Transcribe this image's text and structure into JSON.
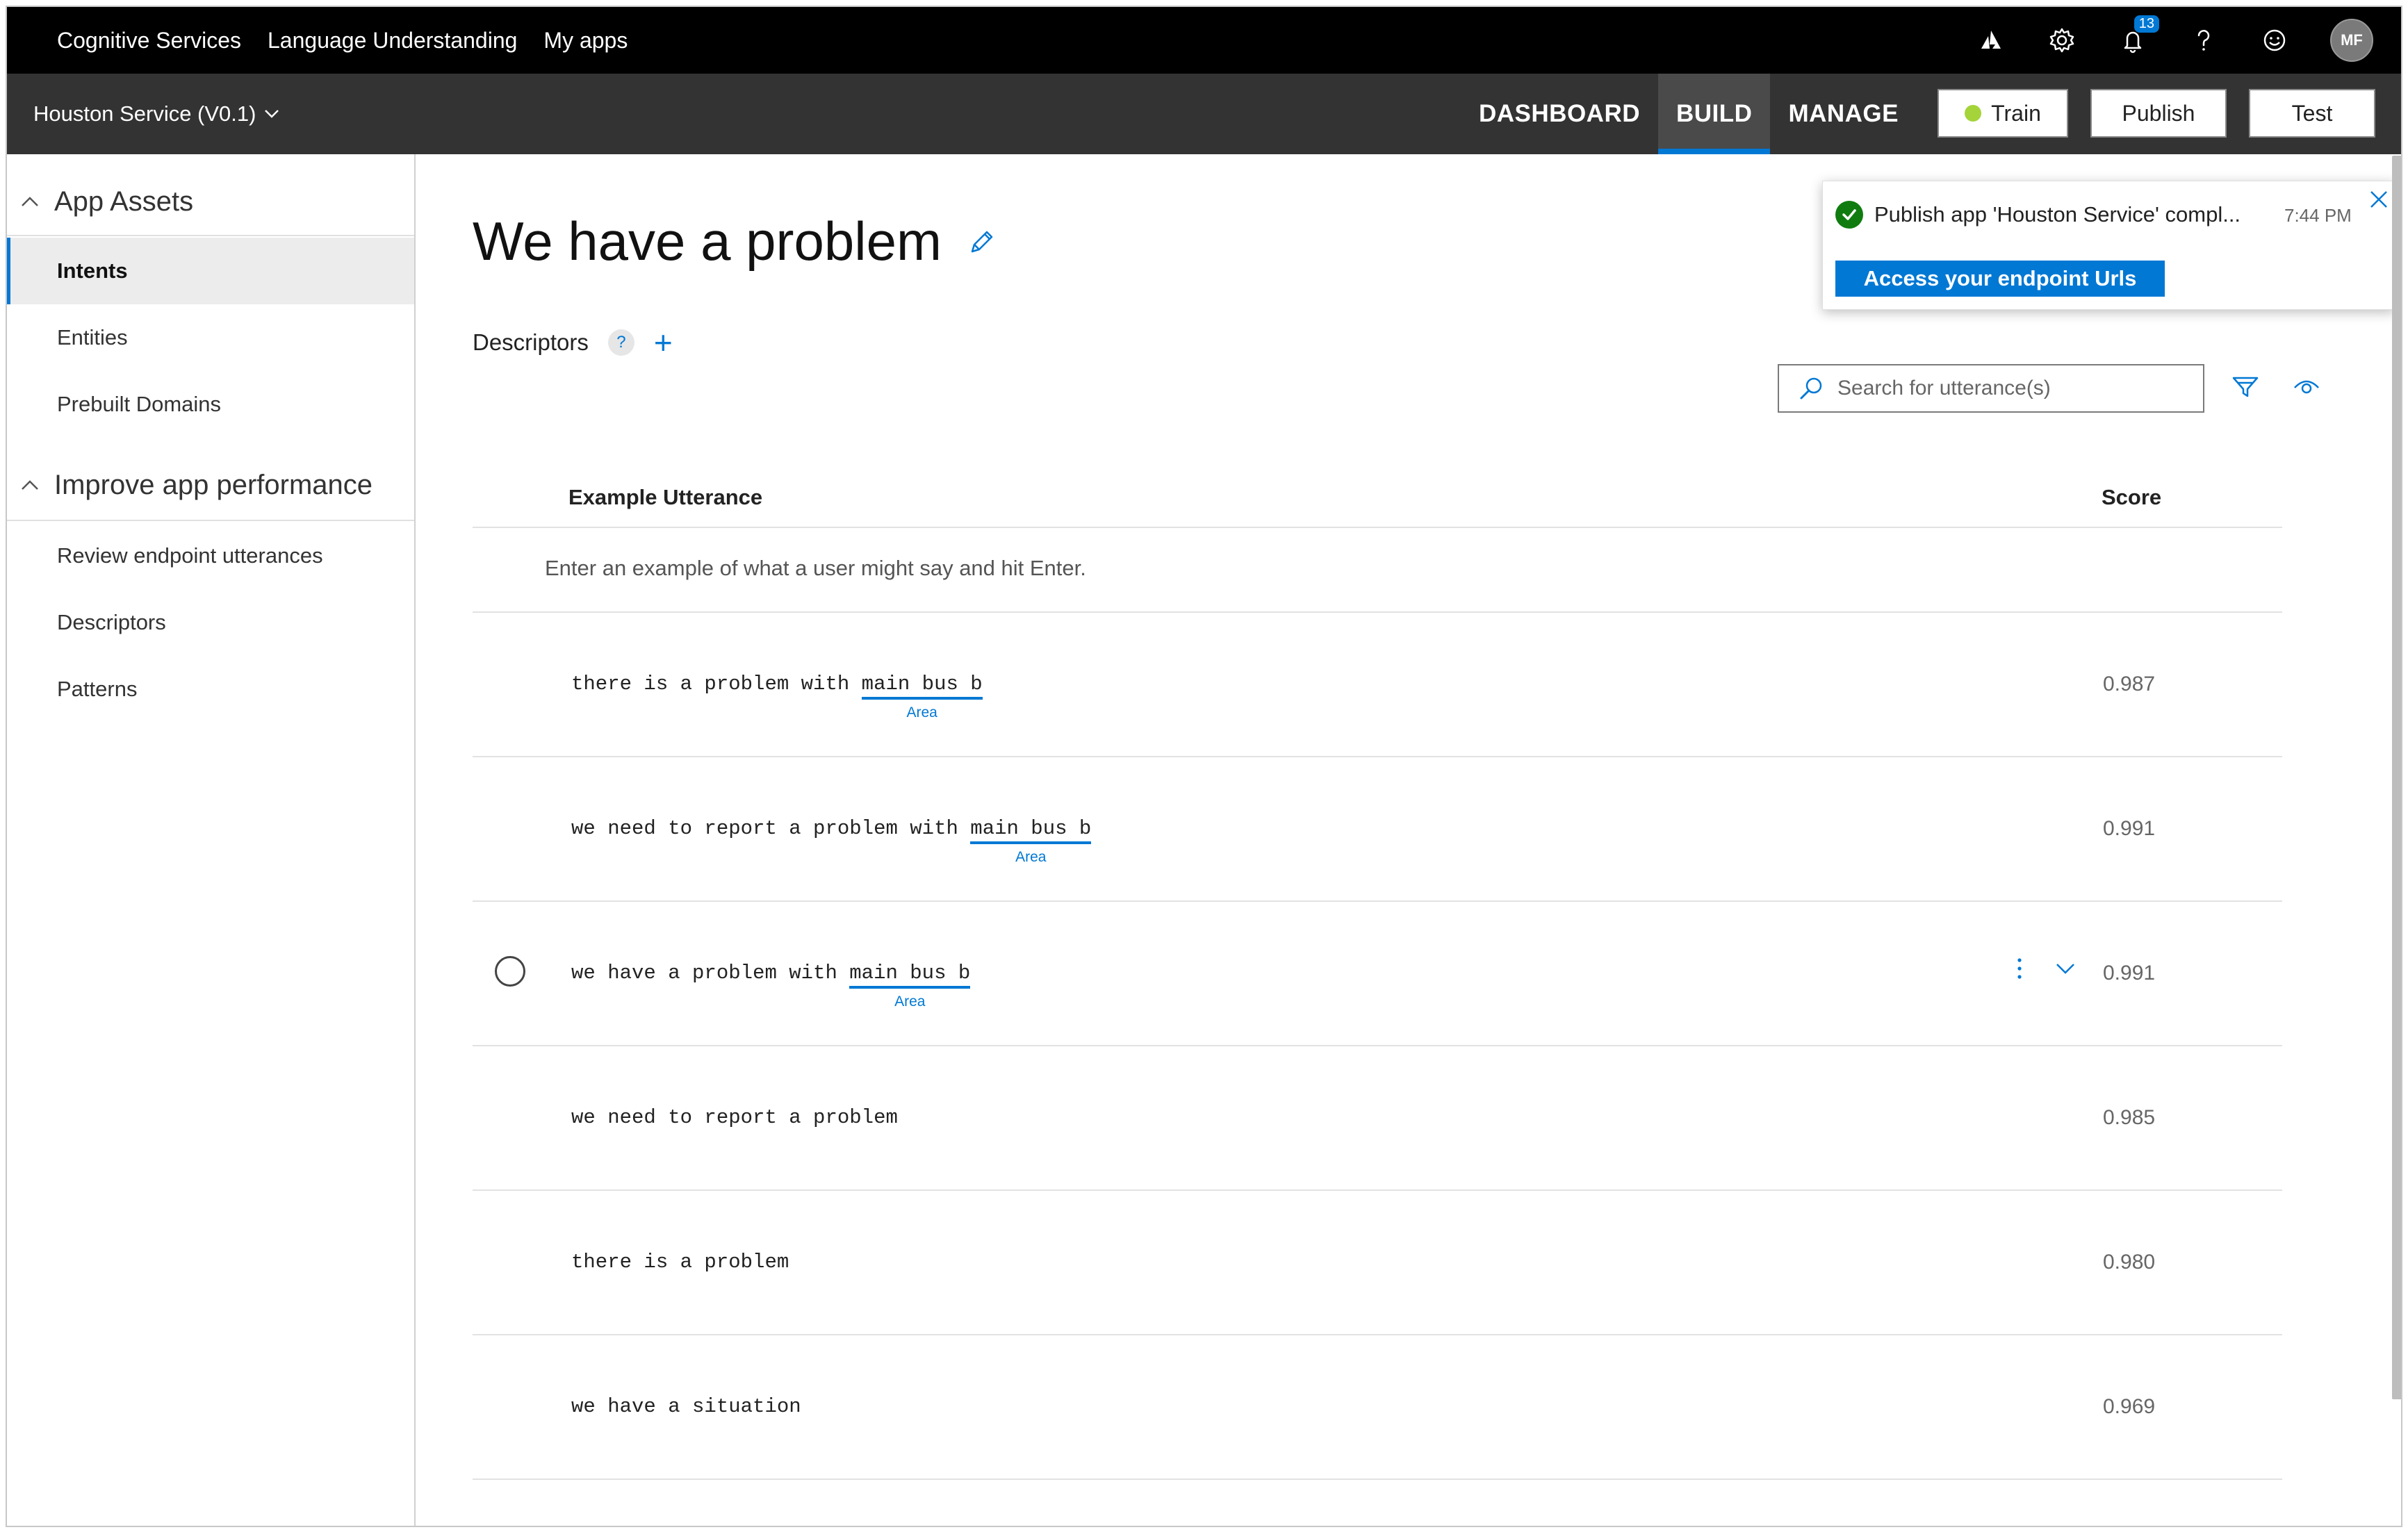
{
  "topbar": {
    "breadcrumbs": [
      "Cognitive Services",
      "Language Understanding",
      "My apps"
    ],
    "notification_count": "13",
    "avatar_initials": "MF",
    "icons": [
      "azure-icon",
      "gear-icon",
      "bell-icon",
      "help-icon",
      "smiley-icon"
    ]
  },
  "appbar": {
    "app_name": "Houston Service (V0.1)",
    "tabs": [
      "DASHBOARD",
      "BUILD",
      "MANAGE"
    ],
    "active_tab": "BUILD",
    "train_label": "Train",
    "publish_label": "Publish",
    "test_label": "Test",
    "train_status_color": "#a4d43a"
  },
  "sidebar": {
    "section1_title": "App Assets",
    "section1_items": [
      "Intents",
      "Entities",
      "Prebuilt Domains"
    ],
    "active_item": "Intents",
    "section2_title": "Improve app performance",
    "section2_items": [
      "Review endpoint utterances",
      "Descriptors",
      "Patterns"
    ]
  },
  "main": {
    "title": "We have a problem",
    "descriptors_label": "Descriptors",
    "help_glyph": "?",
    "search_placeholder": "Search for utterance(s)",
    "col_utterance": "Example Utterance",
    "col_score": "Score",
    "new_utterance_placeholder": "Enter an example of what a user might say and hit Enter.",
    "utterances": [
      {
        "before": "there is a problem with ",
        "entity": "main bus b",
        "entity_label": "Area",
        "after": "",
        "score": "0.987"
      },
      {
        "before": "we need to report a problem with ",
        "entity": "main bus b",
        "entity_label": "Area",
        "after": "",
        "score": "0.991"
      },
      {
        "before": "we have a problem with ",
        "entity": "main bus b",
        "entity_label": "Area",
        "after": "",
        "score": "0.991"
      },
      {
        "before": "we need to report a problem",
        "entity": "",
        "entity_label": "",
        "after": "",
        "score": "0.985"
      },
      {
        "before": "there is a problem",
        "entity": "",
        "entity_label": "",
        "after": "",
        "score": "0.980"
      },
      {
        "before": "we have a situation",
        "entity": "",
        "entity_label": "",
        "after": "",
        "score": "0.969"
      }
    ]
  },
  "notification": {
    "message": "Publish app 'Houston Service' compl...",
    "time": "7:44 PM",
    "action_label": "Access your endpoint Urls"
  },
  "colors": {
    "accent": "#0078d4",
    "topbar_bg": "#000000",
    "appbar_bg": "#333333",
    "success": "#107c10"
  }
}
